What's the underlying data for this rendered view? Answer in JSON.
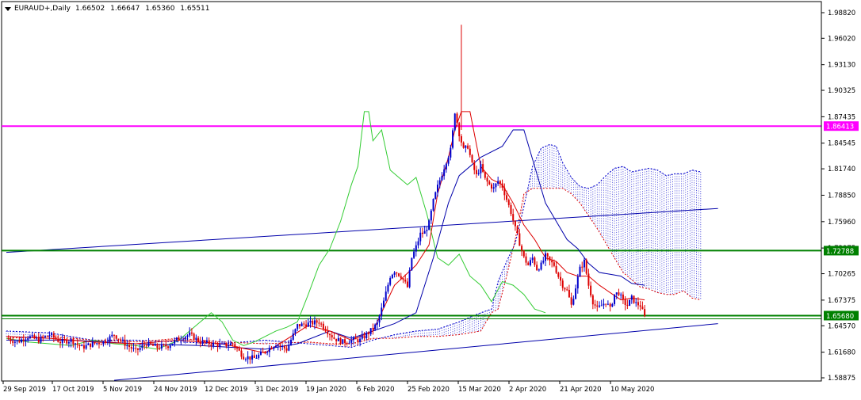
{
  "header": {
    "symbol": "EURAUD+,Daily",
    "open": "1.66502",
    "high": "1.66647",
    "low": "1.65360",
    "close": "1.65511"
  },
  "colors": {
    "background": "#ffffff",
    "frame": "#000000",
    "bull_candle": "#0000cc",
    "bear_candle": "#dd0000",
    "tenkan": "#dd0000",
    "kijun": "#0000aa",
    "chikou": "#33cc33",
    "kumo_bull": "#0000cc",
    "kumo_bear": "#dd0000",
    "magenta_level": "#ff00ff",
    "green_level": "#008000",
    "trendline": "#0000aa",
    "label_text": "#ffffff"
  },
  "chart_data": {
    "type": "candlestick",
    "instrument": "EURAUD+",
    "timeframe": "Daily",
    "y_axis": {
      "ticks": [
        "1.98820",
        "1.96020",
        "1.93130",
        "1.90325",
        "1.87435",
        "1.84545",
        "1.81740",
        "1.78850",
        "1.75960",
        "1.73075",
        "1.70265",
        "1.67375",
        "1.64570",
        "1.61680",
        "1.58875"
      ],
      "range": [
        1.58875,
        1.9882
      ]
    },
    "x_axis": {
      "ticks": [
        "29 Sep 2019",
        "17 Oct 2019",
        "5 Nov 2019",
        "24 Nov 2019",
        "12 Dec 2019",
        "31 Dec 2019",
        "19 Jan 2020",
        "6 Feb 2020",
        "25 Feb 2020",
        "15 Mar 2020",
        "2 Apr 2020",
        "21 Apr 2020",
        "10 May 2020"
      ]
    },
    "horizontal_levels": [
      {
        "value": 1.86413,
        "label": "1.86413",
        "color": "#ff00ff"
      },
      {
        "value": 1.72788,
        "label": "1.72788",
        "color": "#008000"
      },
      {
        "value": 1.6568,
        "label": "1.65680",
        "color": "#008000"
      }
    ],
    "price_close_path": [
      [
        0,
        1.632
      ],
      [
        5,
        1.628
      ],
      [
        10,
        1.634
      ],
      [
        15,
        1.63
      ],
      [
        20,
        1.636
      ],
      [
        25,
        1.628
      ],
      [
        30,
        1.63
      ],
      [
        35,
        1.622
      ],
      [
        40,
        1.626
      ],
      [
        45,
        1.628
      ],
      [
        50,
        1.636
      ],
      [
        55,
        1.626
      ],
      [
        60,
        1.618
      ],
      [
        65,
        1.626
      ],
      [
        70,
        1.622
      ],
      [
        75,
        1.624
      ],
      [
        80,
        1.632
      ],
      [
        85,
        1.636
      ],
      [
        90,
        1.628
      ],
      [
        95,
        1.626
      ],
      [
        100,
        1.624
      ],
      [
        105,
        1.626
      ],
      [
        110,
        1.612
      ],
      [
        115,
        1.61
      ],
      [
        120,
        1.618
      ],
      [
        125,
        1.626
      ],
      [
        130,
        1.62
      ],
      [
        135,
        1.646
      ],
      [
        140,
        1.648
      ],
      [
        145,
        1.65
      ],
      [
        148,
        1.642
      ],
      [
        152,
        1.632
      ],
      [
        156,
        1.628
      ],
      [
        160,
        1.63
      ],
      [
        164,
        1.63
      ],
      [
        168,
        1.638
      ],
      [
        172,
        1.648
      ],
      [
        175,
        1.672
      ],
      [
        178,
        1.7
      ],
      [
        180,
        1.706
      ],
      [
        183,
        1.7
      ],
      [
        186,
        1.688
      ],
      [
        188,
        1.72
      ],
      [
        190,
        1.732
      ],
      [
        192,
        1.746
      ],
      [
        194,
        1.748
      ],
      [
        196,
        1.758
      ],
      [
        198,
        1.782
      ],
      [
        200,
        1.798
      ],
      [
        202,
        1.812
      ],
      [
        204,
        1.826
      ],
      [
        206,
        1.838
      ],
      [
        207,
        1.858
      ],
      [
        208,
        1.88
      ],
      [
        209,
        1.868
      ],
      [
        210,
        1.856
      ],
      [
        212,
        1.838
      ],
      [
        214,
        1.842
      ],
      [
        216,
        1.822
      ],
      [
        218,
        1.81
      ],
      [
        220,
        1.82
      ],
      [
        222,
        1.806
      ],
      [
        224,
        1.8
      ],
      [
        226,
        1.796
      ],
      [
        228,
        1.804
      ],
      [
        230,
        1.798
      ],
      [
        232,
        1.784
      ],
      [
        234,
        1.77
      ],
      [
        236,
        1.752
      ],
      [
        238,
        1.736
      ],
      [
        240,
        1.72
      ],
      [
        242,
        1.712
      ],
      [
        244,
        1.72
      ],
      [
        246,
        1.708
      ],
      [
        248,
        1.712
      ],
      [
        250,
        1.722
      ],
      [
        252,
        1.716
      ],
      [
        254,
        1.712
      ],
      [
        256,
        1.7
      ],
      [
        258,
        1.69
      ],
      [
        260,
        1.684
      ],
      [
        262,
        1.668
      ],
      [
        264,
        1.688
      ],
      [
        266,
        1.708
      ],
      [
        268,
        1.716
      ],
      [
        270,
        1.69
      ],
      [
        272,
        1.672
      ],
      [
        274,
        1.664
      ],
      [
        276,
        1.668
      ],
      [
        278,
        1.672
      ],
      [
        280,
        1.664
      ],
      [
        282,
        1.68
      ],
      [
        284,
        1.682
      ],
      [
        286,
        1.672
      ],
      [
        288,
        1.668
      ],
      [
        290,
        1.676
      ],
      [
        292,
        1.67
      ],
      [
        294,
        1.668
      ],
      [
        296,
        1.655
      ]
    ],
    "spike_high": {
      "bar": 211,
      "value": 1.975
    },
    "tenkan_sen": [
      [
        0,
        1.634
      ],
      [
        20,
        1.632
      ],
      [
        40,
        1.628
      ],
      [
        60,
        1.626
      ],
      [
        80,
        1.63
      ],
      [
        100,
        1.626
      ],
      [
        120,
        1.616
      ],
      [
        140,
        1.646
      ],
      [
        150,
        1.64
      ],
      [
        160,
        1.63
      ],
      [
        170,
        1.64
      ],
      [
        180,
        1.69
      ],
      [
        190,
        1.712
      ],
      [
        196,
        1.734
      ],
      [
        200,
        1.79
      ],
      [
        205,
        1.83
      ],
      [
        208,
        1.86
      ],
      [
        211,
        1.88
      ],
      [
        215,
        1.88
      ],
      [
        220,
        1.82
      ],
      [
        225,
        1.806
      ],
      [
        230,
        1.8
      ],
      [
        235,
        1.78
      ],
      [
        240,
        1.756
      ],
      [
        245,
        1.74
      ],
      [
        250,
        1.72
      ],
      [
        255,
        1.716
      ],
      [
        260,
        1.704
      ],
      [
        265,
        1.7
      ],
      [
        270,
        1.7
      ],
      [
        275,
        1.69
      ],
      [
        280,
        1.682
      ],
      [
        285,
        1.674
      ],
      [
        290,
        1.676
      ],
      [
        296,
        1.674
      ]
    ],
    "kijun_sen": [
      [
        0,
        1.63
      ],
      [
        30,
        1.63
      ],
      [
        60,
        1.626
      ],
      [
        90,
        1.624
      ],
      [
        120,
        1.62
      ],
      [
        135,
        1.626
      ],
      [
        150,
        1.64
      ],
      [
        160,
        1.632
      ],
      [
        170,
        1.64
      ],
      [
        180,
        1.648
      ],
      [
        190,
        1.66
      ],
      [
        198,
        1.72
      ],
      [
        205,
        1.78
      ],
      [
        210,
        1.81
      ],
      [
        220,
        1.83
      ],
      [
        230,
        1.842
      ],
      [
        235,
        1.86
      ],
      [
        240,
        1.86
      ],
      [
        245,
        1.82
      ],
      [
        250,
        1.78
      ],
      [
        255,
        1.76
      ],
      [
        260,
        1.74
      ],
      [
        265,
        1.73
      ],
      [
        270,
        1.714
      ],
      [
        275,
        1.704
      ],
      [
        280,
        1.702
      ],
      [
        285,
        1.7
      ],
      [
        290,
        1.692
      ],
      [
        296,
        1.69
      ]
    ],
    "chikou_span": [
      [
        0,
        1.632
      ],
      [
        10,
        1.628
      ],
      [
        20,
        1.626
      ],
      [
        30,
        1.624
      ],
      [
        40,
        1.63
      ],
      [
        50,
        1.626
      ],
      [
        60,
        1.624
      ],
      [
        70,
        1.62
      ],
      [
        80,
        1.63
      ],
      [
        90,
        1.65
      ],
      [
        95,
        1.66
      ],
      [
        100,
        1.65
      ],
      [
        105,
        1.63
      ],
      [
        110,
        1.624
      ],
      [
        115,
        1.628
      ],
      [
        120,
        1.634
      ],
      [
        125,
        1.64
      ],
      [
        130,
        1.644
      ],
      [
        135,
        1.65
      ],
      [
        140,
        1.68
      ],
      [
        145,
        1.712
      ],
      [
        150,
        1.73
      ],
      [
        155,
        1.76
      ],
      [
        160,
        1.8
      ],
      [
        163,
        1.82
      ],
      [
        166,
        1.88
      ],
      [
        168,
        1.88
      ],
      [
        170,
        1.848
      ],
      [
        174,
        1.86
      ],
      [
        178,
        1.816
      ],
      [
        182,
        1.808
      ],
      [
        186,
        1.8
      ],
      [
        190,
        1.808
      ],
      [
        195,
        1.768
      ],
      [
        200,
        1.72
      ],
      [
        205,
        1.712
      ],
      [
        210,
        1.724
      ],
      [
        215,
        1.7
      ],
      [
        220,
        1.69
      ],
      [
        225,
        1.672
      ],
      [
        230,
        1.694
      ],
      [
        235,
        1.69
      ],
      [
        240,
        1.68
      ],
      [
        245,
        1.664
      ],
      [
        250,
        1.66
      ]
    ],
    "senkou_span_a": [
      [
        0,
        1.64
      ],
      [
        20,
        1.638
      ],
      [
        40,
        1.63
      ],
      [
        60,
        1.63
      ],
      [
        80,
        1.628
      ],
      [
        100,
        1.626
      ],
      [
        120,
        1.63
      ],
      [
        140,
        1.626
      ],
      [
        150,
        1.624
      ],
      [
        160,
        1.622
      ],
      [
        170,
        1.63
      ],
      [
        180,
        1.636
      ],
      [
        190,
        1.64
      ],
      [
        200,
        1.642
      ],
      [
        210,
        1.65
      ],
      [
        220,
        1.66
      ],
      [
        225,
        1.664
      ],
      [
        228,
        1.694
      ],
      [
        232,
        1.716
      ],
      [
        236,
        1.736
      ],
      [
        240,
        1.776
      ],
      [
        244,
        1.82
      ],
      [
        248,
        1.84
      ],
      [
        252,
        1.844
      ],
      [
        255,
        1.842
      ],
      [
        258,
        1.824
      ],
      [
        262,
        1.808
      ],
      [
        266,
        1.798
      ],
      [
        270,
        1.796
      ],
      [
        274,
        1.8
      ],
      [
        278,
        1.81
      ],
      [
        282,
        1.818
      ],
      [
        286,
        1.82
      ],
      [
        290,
        1.814
      ],
      [
        294,
        1.816
      ],
      [
        298,
        1.818
      ],
      [
        302,
        1.816
      ],
      [
        306,
        1.81
      ],
      [
        310,
        1.812
      ],
      [
        314,
        1.812
      ],
      [
        318,
        1.816
      ],
      [
        322,
        1.814
      ]
    ],
    "senkou_span_b": [
      [
        0,
        1.632
      ],
      [
        20,
        1.634
      ],
      [
        40,
        1.63
      ],
      [
        60,
        1.628
      ],
      [
        80,
        1.632
      ],
      [
        100,
        1.628
      ],
      [
        120,
        1.626
      ],
      [
        140,
        1.628
      ],
      [
        150,
        1.626
      ],
      [
        160,
        1.626
      ],
      [
        170,
        1.632
      ],
      [
        180,
        1.632
      ],
      [
        190,
        1.634
      ],
      [
        200,
        1.634
      ],
      [
        210,
        1.636
      ],
      [
        220,
        1.64
      ],
      [
        225,
        1.66
      ],
      [
        228,
        1.664
      ],
      [
        232,
        1.7
      ],
      [
        236,
        1.74
      ],
      [
        240,
        1.79
      ],
      [
        244,
        1.796
      ],
      [
        248,
        1.796
      ],
      [
        252,
        1.796
      ],
      [
        255,
        1.796
      ],
      [
        258,
        1.796
      ],
      [
        262,
        1.79
      ],
      [
        266,
        1.78
      ],
      [
        270,
        1.766
      ],
      [
        274,
        1.752
      ],
      [
        278,
        1.736
      ],
      [
        282,
        1.72
      ],
      [
        286,
        1.704
      ],
      [
        290,
        1.696
      ],
      [
        294,
        1.688
      ],
      [
        298,
        1.686
      ],
      [
        302,
        1.682
      ],
      [
        306,
        1.68
      ],
      [
        310,
        1.68
      ],
      [
        314,
        1.684
      ],
      [
        318,
        1.676
      ],
      [
        322,
        1.674
      ]
    ],
    "trendlines": [
      {
        "name": "upper",
        "from": [
          0,
          1.726
        ],
        "to": [
          330,
          1.774
        ]
      },
      {
        "name": "lower",
        "from": [
          50,
          1.586
        ],
        "to": [
          330,
          1.648
        ]
      }
    ]
  }
}
